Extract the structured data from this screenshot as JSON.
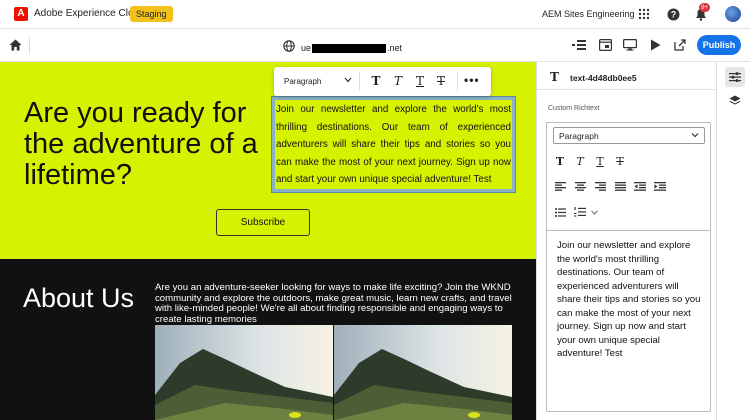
{
  "header": {
    "logo_letter": "A",
    "app_title": "Adobe Experience Cloud",
    "environment_badge": "Staging",
    "org_name": "AEM Sites Engineering",
    "notification_count": "9+"
  },
  "toolbar": {
    "url_prefix": "ue",
    "url_suffix": ".net",
    "publish_label": "Publish"
  },
  "page": {
    "hero_title": "Are you ready for the adventure of a lifetime?",
    "hero_text": "Join our newsletter and explore the world's most thrilling destinations. Our team of experienced adventurers will share their tips and stories so you can make the most of your next journey. Sign up now and start your own unique special adventure! Test",
    "subscribe_label": "Subscribe",
    "about_title": "About Us",
    "about_text": "Are you an adventure-seeker looking for ways to make life exciting? Join the WKND community and explore the outdoors, make great music, learn new crafts, and travel with like-minded people! We're all about finding responsible and engaging ways to create lasting memories"
  },
  "floating_toolbar": {
    "paragraph_label": "Paragraph"
  },
  "panel": {
    "component_id": "text-4d48db0ee5",
    "field_label": "Custom Richtext",
    "format_value": "Paragraph",
    "content": "Join our newsletter and explore the world's most thrilling destinations. Our team of experienced adventurers will share their tips and stories so you can make the most of your next journey. Sign up now and start your own unique special adventure! Test"
  },
  "colors": {
    "hero_background": "#d7f200",
    "about_background": "#111111",
    "accent_blue": "#1473e6",
    "staging_yellow": "#f1c21b",
    "adobe_red": "#eb1000"
  },
  "icons": [
    "adobe-logo-icon",
    "apps-grid-icon",
    "help-icon",
    "bell-icon",
    "home-icon",
    "globe-icon",
    "outline-tree-icon",
    "emulator-icon",
    "desktop-icon",
    "play-icon",
    "open-external-icon",
    "properties-icon",
    "layers-icon",
    "text-component-icon"
  ]
}
